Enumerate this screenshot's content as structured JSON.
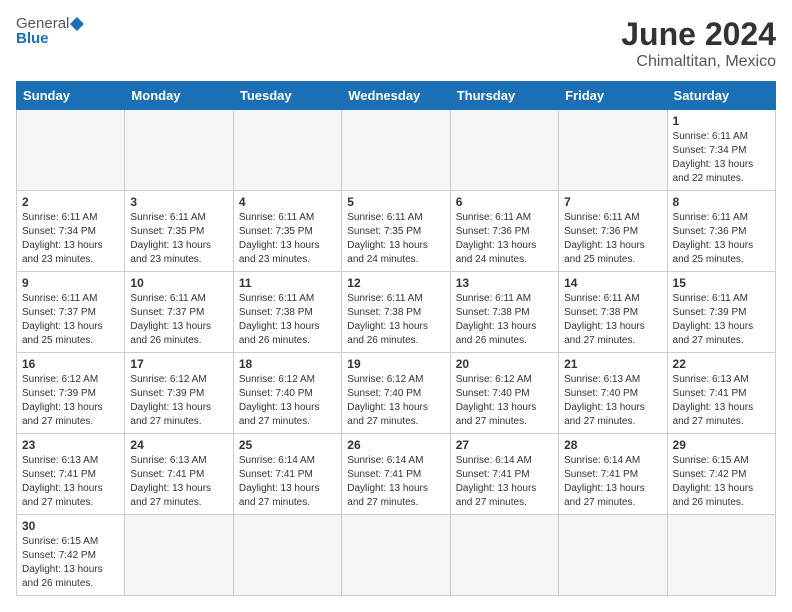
{
  "header": {
    "logo_general": "General",
    "logo_blue": "Blue",
    "month_year": "June 2024",
    "location": "Chimaltitan, Mexico"
  },
  "weekdays": [
    "Sunday",
    "Monday",
    "Tuesday",
    "Wednesday",
    "Thursday",
    "Friday",
    "Saturday"
  ],
  "weeks": [
    [
      {
        "day": "",
        "empty": true
      },
      {
        "day": "",
        "empty": true
      },
      {
        "day": "",
        "empty": true
      },
      {
        "day": "",
        "empty": true
      },
      {
        "day": "",
        "empty": true
      },
      {
        "day": "",
        "empty": true
      },
      {
        "day": "1",
        "sunrise": "Sunrise: 6:11 AM",
        "sunset": "Sunset: 7:34 PM",
        "daylight": "Daylight: 13 hours and 22 minutes."
      }
    ],
    [
      {
        "day": "2",
        "sunrise": "Sunrise: 6:11 AM",
        "sunset": "Sunset: 7:34 PM",
        "daylight": "Daylight: 13 hours and 23 minutes."
      },
      {
        "day": "3",
        "sunrise": "Sunrise: 6:11 AM",
        "sunset": "Sunset: 7:35 PM",
        "daylight": "Daylight: 13 hours and 23 minutes."
      },
      {
        "day": "4",
        "sunrise": "Sunrise: 6:11 AM",
        "sunset": "Sunset: 7:35 PM",
        "daylight": "Daylight: 13 hours and 23 minutes."
      },
      {
        "day": "5",
        "sunrise": "Sunrise: 6:11 AM",
        "sunset": "Sunset: 7:35 PM",
        "daylight": "Daylight: 13 hours and 24 minutes."
      },
      {
        "day": "6",
        "sunrise": "Sunrise: 6:11 AM",
        "sunset": "Sunset: 7:36 PM",
        "daylight": "Daylight: 13 hours and 24 minutes."
      },
      {
        "day": "7",
        "sunrise": "Sunrise: 6:11 AM",
        "sunset": "Sunset: 7:36 PM",
        "daylight": "Daylight: 13 hours and 25 minutes."
      },
      {
        "day": "8",
        "sunrise": "Sunrise: 6:11 AM",
        "sunset": "Sunset: 7:36 PM",
        "daylight": "Daylight: 13 hours and 25 minutes."
      }
    ],
    [
      {
        "day": "9",
        "sunrise": "Sunrise: 6:11 AM",
        "sunset": "Sunset: 7:37 PM",
        "daylight": "Daylight: 13 hours and 25 minutes."
      },
      {
        "day": "10",
        "sunrise": "Sunrise: 6:11 AM",
        "sunset": "Sunset: 7:37 PM",
        "daylight": "Daylight: 13 hours and 26 minutes."
      },
      {
        "day": "11",
        "sunrise": "Sunrise: 6:11 AM",
        "sunset": "Sunset: 7:38 PM",
        "daylight": "Daylight: 13 hours and 26 minutes."
      },
      {
        "day": "12",
        "sunrise": "Sunrise: 6:11 AM",
        "sunset": "Sunset: 7:38 PM",
        "daylight": "Daylight: 13 hours and 26 minutes."
      },
      {
        "day": "13",
        "sunrise": "Sunrise: 6:11 AM",
        "sunset": "Sunset: 7:38 PM",
        "daylight": "Daylight: 13 hours and 26 minutes."
      },
      {
        "day": "14",
        "sunrise": "Sunrise: 6:11 AM",
        "sunset": "Sunset: 7:38 PM",
        "daylight": "Daylight: 13 hours and 27 minutes."
      },
      {
        "day": "15",
        "sunrise": "Sunrise: 6:11 AM",
        "sunset": "Sunset: 7:39 PM",
        "daylight": "Daylight: 13 hours and 27 minutes."
      }
    ],
    [
      {
        "day": "16",
        "sunrise": "Sunrise: 6:12 AM",
        "sunset": "Sunset: 7:39 PM",
        "daylight": "Daylight: 13 hours and 27 minutes."
      },
      {
        "day": "17",
        "sunrise": "Sunrise: 6:12 AM",
        "sunset": "Sunset: 7:39 PM",
        "daylight": "Daylight: 13 hours and 27 minutes."
      },
      {
        "day": "18",
        "sunrise": "Sunrise: 6:12 AM",
        "sunset": "Sunset: 7:40 PM",
        "daylight": "Daylight: 13 hours and 27 minutes."
      },
      {
        "day": "19",
        "sunrise": "Sunrise: 6:12 AM",
        "sunset": "Sunset: 7:40 PM",
        "daylight": "Daylight: 13 hours and 27 minutes."
      },
      {
        "day": "20",
        "sunrise": "Sunrise: 6:12 AM",
        "sunset": "Sunset: 7:40 PM",
        "daylight": "Daylight: 13 hours and 27 minutes."
      },
      {
        "day": "21",
        "sunrise": "Sunrise: 6:13 AM",
        "sunset": "Sunset: 7:40 PM",
        "daylight": "Daylight: 13 hours and 27 minutes."
      },
      {
        "day": "22",
        "sunrise": "Sunrise: 6:13 AM",
        "sunset": "Sunset: 7:41 PM",
        "daylight": "Daylight: 13 hours and 27 minutes."
      }
    ],
    [
      {
        "day": "23",
        "sunrise": "Sunrise: 6:13 AM",
        "sunset": "Sunset: 7:41 PM",
        "daylight": "Daylight: 13 hours and 27 minutes."
      },
      {
        "day": "24",
        "sunrise": "Sunrise: 6:13 AM",
        "sunset": "Sunset: 7:41 PM",
        "daylight": "Daylight: 13 hours and 27 minutes."
      },
      {
        "day": "25",
        "sunrise": "Sunrise: 6:14 AM",
        "sunset": "Sunset: 7:41 PM",
        "daylight": "Daylight: 13 hours and 27 minutes."
      },
      {
        "day": "26",
        "sunrise": "Sunrise: 6:14 AM",
        "sunset": "Sunset: 7:41 PM",
        "daylight": "Daylight: 13 hours and 27 minutes."
      },
      {
        "day": "27",
        "sunrise": "Sunrise: 6:14 AM",
        "sunset": "Sunset: 7:41 PM",
        "daylight": "Daylight: 13 hours and 27 minutes."
      },
      {
        "day": "28",
        "sunrise": "Sunrise: 6:14 AM",
        "sunset": "Sunset: 7:41 PM",
        "daylight": "Daylight: 13 hours and 27 minutes."
      },
      {
        "day": "29",
        "sunrise": "Sunrise: 6:15 AM",
        "sunset": "Sunset: 7:42 PM",
        "daylight": "Daylight: 13 hours and 26 minutes."
      }
    ],
    [
      {
        "day": "30",
        "sunrise": "Sunrise: 6:15 AM",
        "sunset": "Sunset: 7:42 PM",
        "daylight": "Daylight: 13 hours and 26 minutes."
      },
      {
        "day": "",
        "empty": true
      },
      {
        "day": "",
        "empty": true
      },
      {
        "day": "",
        "empty": true
      },
      {
        "day": "",
        "empty": true
      },
      {
        "day": "",
        "empty": true
      },
      {
        "day": "",
        "empty": true
      }
    ]
  ]
}
